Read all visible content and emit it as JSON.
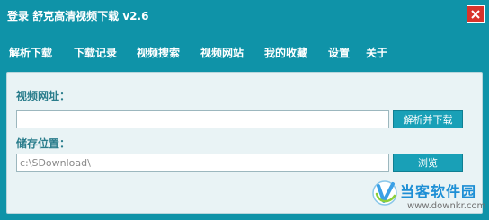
{
  "window": {
    "title": "登录  舒克高清视频下载 v2.6",
    "close_icon": "close-icon",
    "accent": "#0f93a8",
    "close_color": "#d8332b"
  },
  "menu": {
    "items": [
      {
        "label": "解析下载"
      },
      {
        "label": "下载记录"
      },
      {
        "label": "视频搜索"
      },
      {
        "label": "视频网站"
      },
      {
        "label": "我的收藏"
      },
      {
        "label": "设置"
      },
      {
        "label": "关于"
      }
    ]
  },
  "form": {
    "url_label": "视频网址：",
    "url_value": "",
    "parse_button": "解析并下载",
    "save_label": "储存位置：",
    "save_path": "c:\\SDownload\\",
    "browse_button": "浏览"
  },
  "watermark": {
    "title": "当客软件园",
    "url": "www.downkr.com"
  }
}
